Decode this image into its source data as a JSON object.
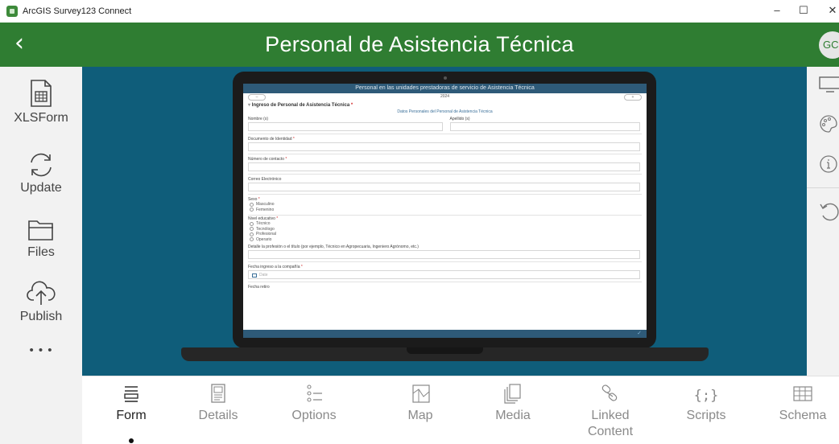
{
  "window": {
    "title": "ArcGIS Survey123 Connect",
    "minimize": "–",
    "maximize": "☐",
    "close": "✕"
  },
  "header": {
    "back_icon": "chevron-left-icon",
    "title": "Personal de Asistencia Técnica",
    "avatar_initials": "GC",
    "color": "#2f7d32"
  },
  "sidebar": {
    "items": [
      {
        "label": "XLSForm",
        "icon": "spreadsheet-icon"
      },
      {
        "label": "Update",
        "icon": "refresh-icon"
      },
      {
        "label": "Files",
        "icon": "folder-icon"
      },
      {
        "label": "Publish",
        "icon": "cloud-upload-icon"
      },
      {
        "label": "• • •",
        "icon": "more-icon"
      }
    ]
  },
  "rightbar": {
    "icons": [
      "monitor-icon",
      "palette-icon",
      "info-icon",
      "reset-icon"
    ]
  },
  "preview": {
    "background": "#0f5d7a",
    "form": {
      "header_title": "Personal en las unidades prestadoras de servicio de Asistencia Técnica",
      "sub_value": "2024",
      "pill_left": "–",
      "pill_right": "+",
      "group_label": "Ingreso de Personal de Asistencia Técnica",
      "group_required": "*",
      "section_title": "Datos Personales del Personal de Asistencia Técnica",
      "fields": {
        "nombre": "Nombre (s)",
        "apellido": "Apellido (s)",
        "documento": "Documento de Identidad",
        "contacto": "Número de contacto",
        "correo": "Correo Electrónico",
        "sexo": "Sexo",
        "sexo_options": [
          "Masculino",
          "Femenino"
        ],
        "nivel": "Nivel educativo",
        "nivel_options": [
          "Técnico",
          "Tecnólogo",
          "Profesional",
          "Operario"
        ],
        "detalle": "Detalle la profesión o el título (por ejemplo, Técnico en Agropecuaria, Ingeniero Agrónomo, etc.)",
        "fecha_ingreso": "Fecha ingreso a la compañía",
        "date_placeholder": "Date",
        "fecha_retiro": "Fecha retiro"
      },
      "required_mark": "*",
      "submit_icon": "✓"
    }
  },
  "tabs": [
    {
      "label": "Form",
      "icon": "form-icon",
      "active": true
    },
    {
      "label": "Details",
      "icon": "details-icon",
      "active": false
    },
    {
      "label": "Options",
      "icon": "options-icon",
      "active": false
    },
    {
      "label": "Map",
      "icon": "map-icon",
      "active": false
    },
    {
      "label": "Media",
      "icon": "media-icon",
      "active": false
    },
    {
      "label": "Linked Content",
      "icon": "linked-content-icon",
      "active": false
    },
    {
      "label": "Scripts",
      "icon": "scripts-icon",
      "active": false
    },
    {
      "label": "Schema",
      "icon": "schema-icon",
      "active": false
    }
  ]
}
